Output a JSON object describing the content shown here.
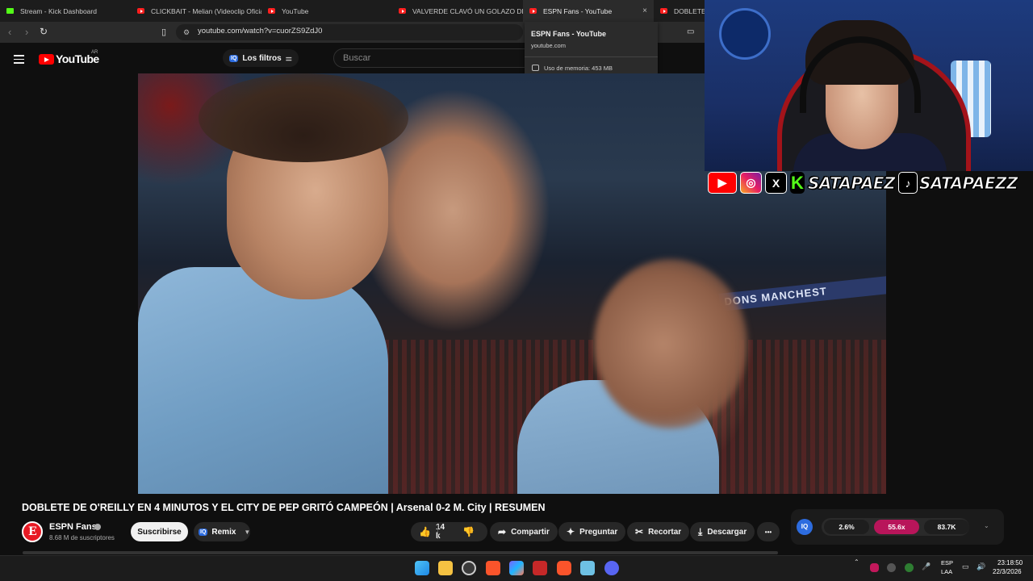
{
  "browser": {
    "tabs": [
      {
        "title": "Stream - Kick Dashboard",
        "icon": "kick-icon"
      },
      {
        "title": "CLICKBAIT - Melian (Videoclip Oficial",
        "icon": "youtube-icon"
      },
      {
        "title": "YouTube",
        "icon": "youtube-icon"
      },
      {
        "title": "VALVERDE CLAVÓ UN GOLAZO DE T",
        "icon": "youtube-icon"
      },
      {
        "title": "ESPN Fans - YouTube",
        "icon": "youtube-icon",
        "active": true,
        "close": "×"
      },
      {
        "title": "DOBLETE",
        "icon": "youtube-icon"
      }
    ],
    "url": "youtube.com/watch?v=cuorZS9ZdJ0",
    "tooltip": {
      "title": "ESPN Fans - YouTube",
      "domain": "youtube.com",
      "memory": "Uso de memoria: 453 MB"
    }
  },
  "youtube": {
    "logo_text": "YouTube",
    "country": "AR",
    "filters_badge": "IQ",
    "filters_label": "Los filtros",
    "search_placeholder": "Buscar",
    "video_overlay_text": "DONS MANCHEST",
    "video_title": "DOBLETE DE O'REILLY EN 4 MINUTOS Y EL CITY DE PEP GRITÓ CAMPEÓN | Arsenal 0-2 M. City | RESUMEN",
    "channel_name": "ESPN Fans",
    "subscribers": "8.68 M de suscriptores",
    "subscribe_label": "Suscribirse",
    "remix_label": "Remix",
    "remix_badge": "IQ",
    "likes": "14 k",
    "share_label": "Compartir",
    "ask_label": "Preguntar",
    "clip_label": "Recortar",
    "download_label": "Descargar",
    "more_label": "•••"
  },
  "iq_panel": {
    "logo": "IQ",
    "stats": [
      {
        "value": "2.6%",
        "color": "#1e1e1e"
      },
      {
        "value": "55.6x",
        "color": "#b8155a"
      },
      {
        "value": "83.7K",
        "color": "#1e1e1e"
      }
    ]
  },
  "overlay": {
    "handle_kick": "SATAPAEZ",
    "handle_tiktok": "SATAPAEZZ",
    "kick_letter": "K",
    "x_letter": "X"
  },
  "taskbar": {
    "lang_top": "ESP",
    "lang_bottom": "LAA",
    "time": "23:18:50",
    "date": "22/3/2026"
  },
  "colors": {
    "youtube_red": "#ff0000",
    "accent_blue": "#2d6cdf",
    "kick_green": "#53fc18"
  }
}
